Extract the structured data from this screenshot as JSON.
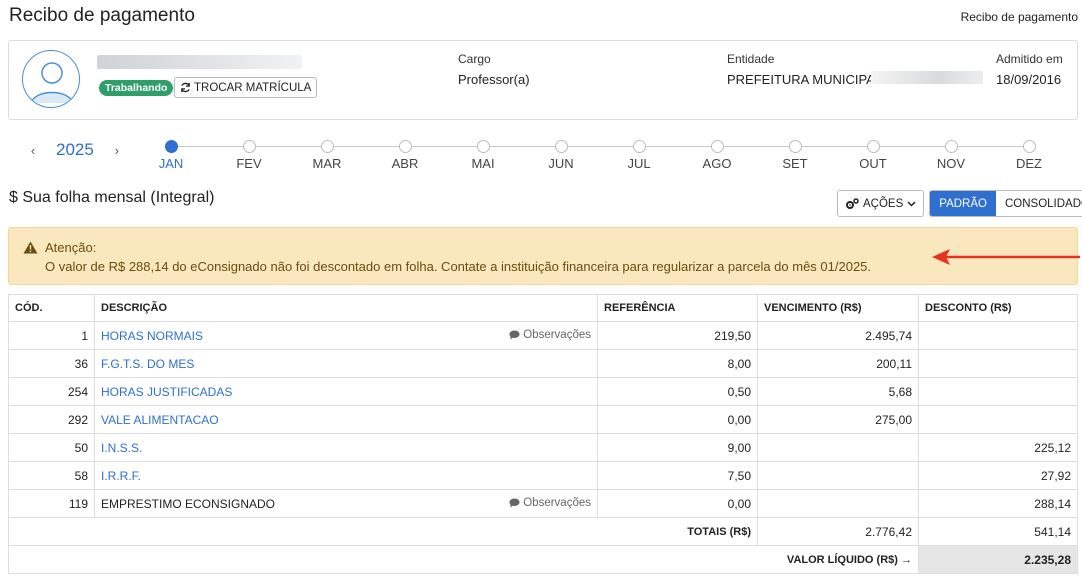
{
  "header": {
    "title": "Recibo de pagamento",
    "breadcrumb": "Recibo de pagamento"
  },
  "profile": {
    "status_badge": "Trabalhando",
    "switch_button": "TROCAR MATRÍCULA",
    "cargo_label": "Cargo",
    "cargo_value": "Professor(a)",
    "entidade_label": "Entidade",
    "entidade_value": "PREFEITURA MUNICIPAL",
    "admitido_label": "Admitido em",
    "admitido_value": "18/09/2016"
  },
  "year_nav": {
    "prev": "‹",
    "year": "2025",
    "next": "›"
  },
  "months": [
    "JAN",
    "FEV",
    "MAR",
    "ABR",
    "MAI",
    "JUN",
    "JUL",
    "AGO",
    "SET",
    "OUT",
    "NOV",
    "DEZ"
  ],
  "active_month": "JAN",
  "section": {
    "title": "$ Sua folha mensal (Integral)",
    "actions_button": "AÇÕES",
    "view_default": "PADRÃO",
    "view_consolidated": "CONSOLIDADO"
  },
  "alert": {
    "title": "Atenção:",
    "message": "O valor de R$ 288,14 do eConsignado não foi descontado em folha. Contate a instituição financeira para regularizar a parcela do mês 01/2025."
  },
  "table": {
    "headers": {
      "code": "CÓD.",
      "description": "DESCRIÇÃO",
      "reference": "REFERÊNCIA",
      "earnings": "VENCIMENTO (R$)",
      "deductions": "DESCONTO (R$)"
    },
    "observations_label": "Observações",
    "rows": [
      {
        "code": "1",
        "description": "HORAS NORMAIS",
        "reference": "219,50",
        "earnings": "2.495,74",
        "deductions": ""
      },
      {
        "code": "36",
        "description": "F.G.T.S. DO MES",
        "reference": "8,00",
        "earnings": "200,11",
        "deductions": ""
      },
      {
        "code": "254",
        "description": "HORAS JUSTIFICADAS",
        "reference": "0,50",
        "earnings": "5,68",
        "deductions": ""
      },
      {
        "code": "292",
        "description": "VALE ALIMENTACAO",
        "reference": "0,00",
        "earnings": "275,00",
        "deductions": ""
      },
      {
        "code": "50",
        "description": "I.N.S.S.",
        "reference": "9,00",
        "earnings": "",
        "deductions": "225,12"
      },
      {
        "code": "58",
        "description": "I.R.R.F.",
        "reference": "7,50",
        "earnings": "",
        "deductions": "27,92"
      },
      {
        "code": "119",
        "description": "EMPRESTIMO ECONSIGNADO",
        "reference": "0,00",
        "earnings": "",
        "deductions": "288,14"
      }
    ],
    "totals_label": "TOTAIS (R$)",
    "totals_earnings": "2.776,42",
    "totals_deductions": "541,14",
    "net_label": "VALOR LÍQUIDO (R$) →",
    "net_value": "2.235,28"
  },
  "colors": {
    "accent": "#2f6fcf",
    "success": "#2e9e6a",
    "alert_bg": "#f9e7bd",
    "annotation_arrow": "#e8321e"
  }
}
